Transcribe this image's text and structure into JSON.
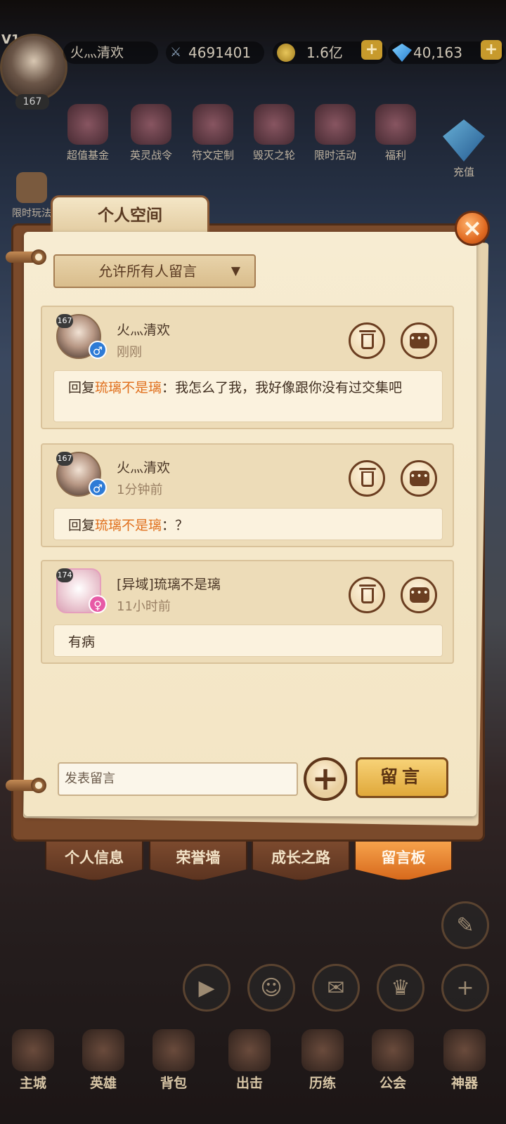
{
  "header": {
    "vip": "V1",
    "player_name": "火灬清欢",
    "level": "167",
    "power": "4691401",
    "gold": "1.6亿",
    "gems": "40,163",
    "plus": "+"
  },
  "events": [
    {
      "label": "超值基金"
    },
    {
      "label": "英灵战令"
    },
    {
      "label": "符文定制"
    },
    {
      "label": "毁灭之轮"
    },
    {
      "label": "限时活动"
    },
    {
      "label": "福利"
    }
  ],
  "recharge_label": "充值",
  "limit_play_label": "限时玩法",
  "dialog": {
    "title": "个人空间",
    "close": "×",
    "permission": {
      "selected": "允许所有人留言",
      "arrow": "▼"
    },
    "messages": [
      {
        "level": "167",
        "name": "火灬清欢",
        "time": "刚刚",
        "gender": "♂",
        "prefix": "回复",
        "target": "琉璃不是璃",
        "text": "：我怎么了我，我好像跟你没有过交集吧"
      },
      {
        "level": "167",
        "name": "火灬清欢",
        "time": "1分钟前",
        "gender": "♂",
        "prefix": "回复",
        "target": "琉璃不是璃",
        "text": "：？"
      },
      {
        "level": "174",
        "name": "[异域]琉璃不是璃",
        "time": "11小时前",
        "gender": "♀",
        "prefix": "",
        "target": "",
        "text": "有病"
      }
    ],
    "compose_placeholder": "发表留言",
    "add": "+",
    "submit": "留言",
    "tabs": [
      "个人信息",
      "荣誉墙",
      "成长之路",
      "留言板"
    ],
    "active_tab": "留言板"
  },
  "bottom_nav": [
    {
      "label": "主城"
    },
    {
      "label": "英雄"
    },
    {
      "label": "背包"
    },
    {
      "label": "出击"
    },
    {
      "label": "历练"
    },
    {
      "label": "公会"
    },
    {
      "label": "神器"
    }
  ]
}
